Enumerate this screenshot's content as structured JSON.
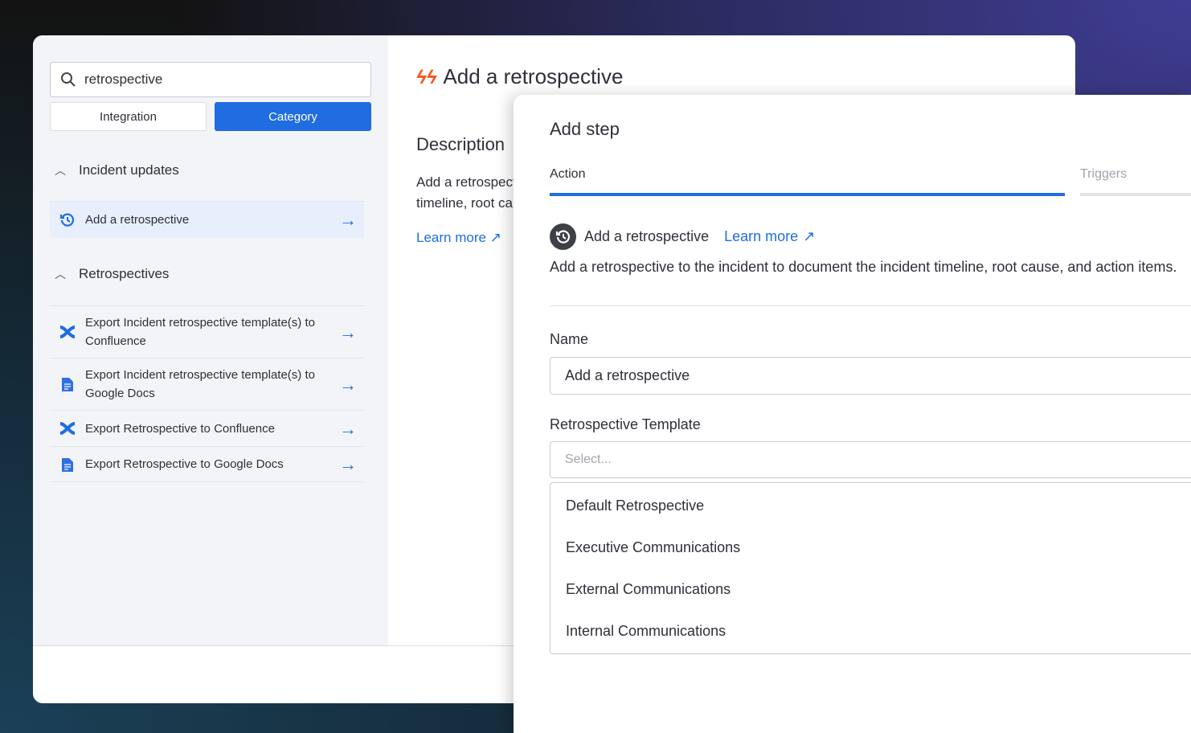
{
  "search": {
    "value": "retrospective"
  },
  "filters": [
    {
      "label": "Integration",
      "active": false
    },
    {
      "label": "Category",
      "active": true
    }
  ],
  "sections": [
    {
      "title": "Incident updates",
      "items": [
        {
          "label": "Add a retrospective",
          "icon": "history-icon",
          "selected": true
        }
      ]
    },
    {
      "title": "Retrospectives",
      "items": [
        {
          "label": "Export Incident retrospective template(s) to Confluence",
          "icon": "confluence-icon"
        },
        {
          "label": "Export Incident retrospective template(s) to Google Docs",
          "icon": "google-docs-icon"
        },
        {
          "label": "Export Retrospective to Confluence",
          "icon": "confluence-icon"
        },
        {
          "label": "Export Retrospective to Google Docs",
          "icon": "google-docs-icon"
        }
      ]
    }
  ],
  "detail": {
    "title": "Add a retrospective",
    "description_heading": "Description",
    "description": "Add a retrospective to the incident to document the incident timeline, root cause, and action items.",
    "learn_more": "Learn more"
  },
  "step": {
    "title": "Add step",
    "tabs": [
      {
        "label": "Action",
        "active": true
      },
      {
        "label": "Triggers",
        "active": false
      }
    ],
    "action_name": "Add a retrospective",
    "learn_more": "Learn more",
    "action_description": "Add a retrospective to the incident to document the incident timeline, root cause, and action items.",
    "name_label": "Name",
    "name_value": "Add a retrospective",
    "template_label": "Retrospective Template",
    "template_placeholder": "Select...",
    "template_options": [
      "Default Retrospective",
      "Executive Communications",
      "External Communications",
      "Internal Communications"
    ]
  },
  "colors": {
    "accent": "#1f6de0",
    "brand": "#f4561f",
    "sidebar": "#f3f4f8"
  }
}
